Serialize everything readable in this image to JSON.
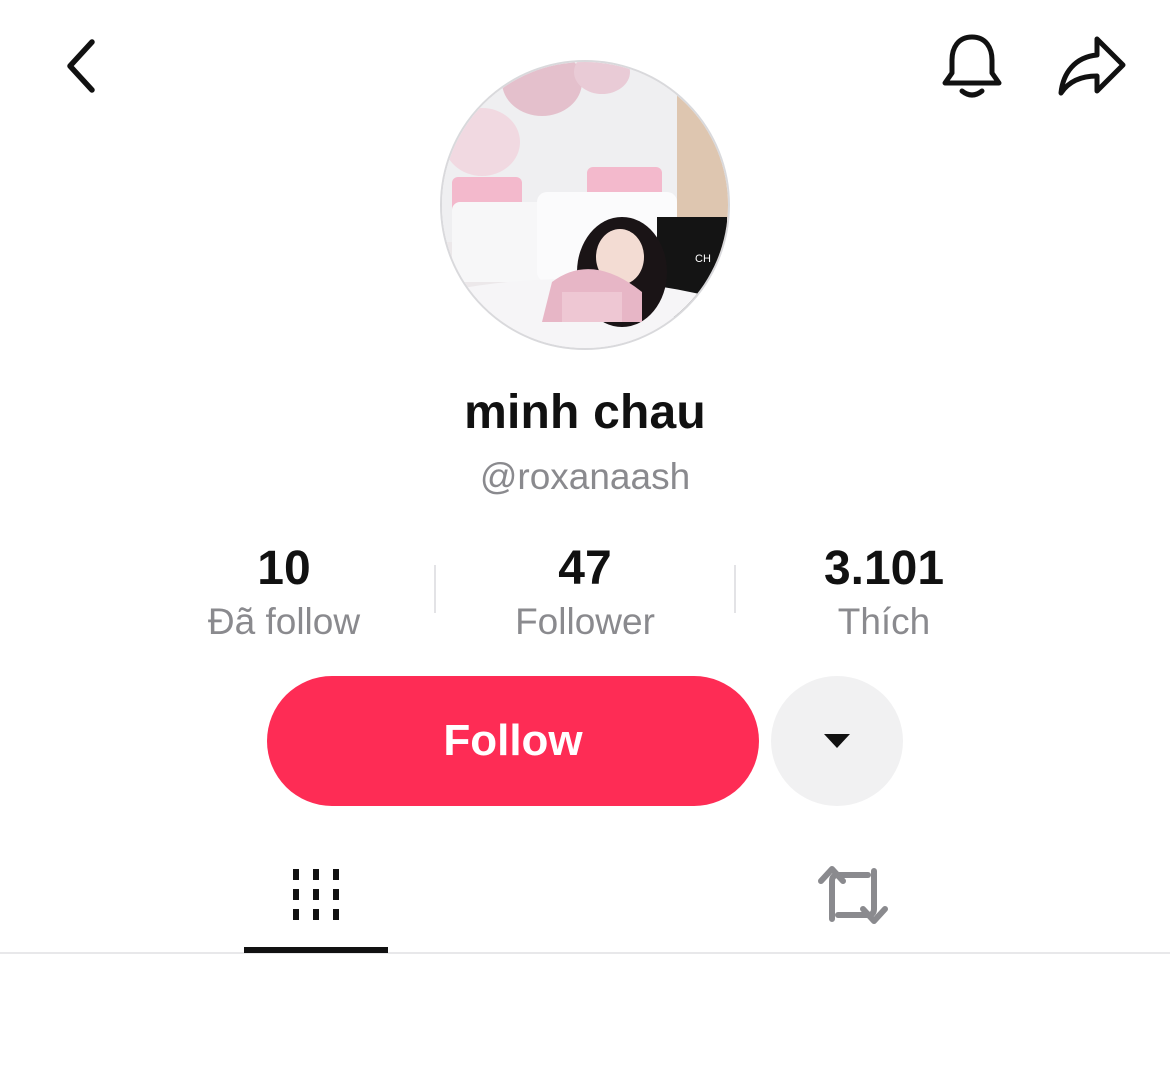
{
  "header": {
    "back_icon": "chevron-left-icon",
    "bell_icon": "bell-icon",
    "share_icon": "share-arrow-icon"
  },
  "profile": {
    "display_name": "minh chau",
    "handle": "@roxanaash",
    "avatar_caption_text": "CH"
  },
  "stats": [
    {
      "value": "10",
      "label": "Đã follow"
    },
    {
      "value": "47",
      "label": "Follower"
    },
    {
      "value": "3.101",
      "label": "Thích"
    }
  ],
  "actions": {
    "follow_label": "Follow",
    "more_icon": "caret-down-icon",
    "follow_color": "#fe2c55"
  },
  "tabs": [
    {
      "icon": "videos-grid-icon",
      "active": true
    },
    {
      "icon": "repost-icon",
      "active": false
    }
  ]
}
